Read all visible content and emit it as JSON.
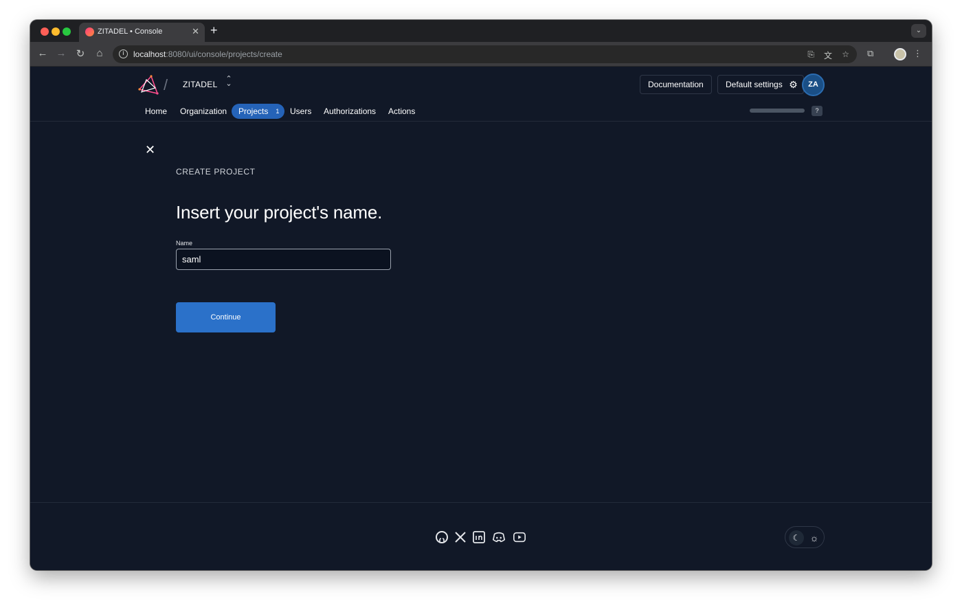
{
  "browser": {
    "tab_title": "ZITADEL • Console",
    "url_host": "localhost",
    "url_path": ":8080/ui/console/projects/create"
  },
  "header": {
    "org_name": "ZITADEL",
    "documentation_label": "Documentation",
    "default_settings_label": "Default settings",
    "avatar_initials": "ZA",
    "help_label": "?"
  },
  "nav": {
    "items": [
      {
        "label": "Home"
      },
      {
        "label": "Organization"
      },
      {
        "label": "Projects",
        "count": "1",
        "active": true
      },
      {
        "label": "Users"
      },
      {
        "label": "Authorizations"
      },
      {
        "label": "Actions"
      }
    ]
  },
  "page": {
    "breadcrumb": "CREATE PROJECT",
    "heading": "Insert your project's name.",
    "name_label": "Name",
    "name_value": "saml",
    "continue_label": "Continue"
  },
  "footer": {
    "social_icons": [
      "github-icon",
      "x-icon",
      "linkedin-icon",
      "discord-icon",
      "youtube-icon"
    ],
    "theme_icons": [
      "moon-icon",
      "sun-icon"
    ]
  },
  "colors": {
    "background": "#111827",
    "accent": "#2b71c9",
    "nav_active": "#2563b8"
  }
}
